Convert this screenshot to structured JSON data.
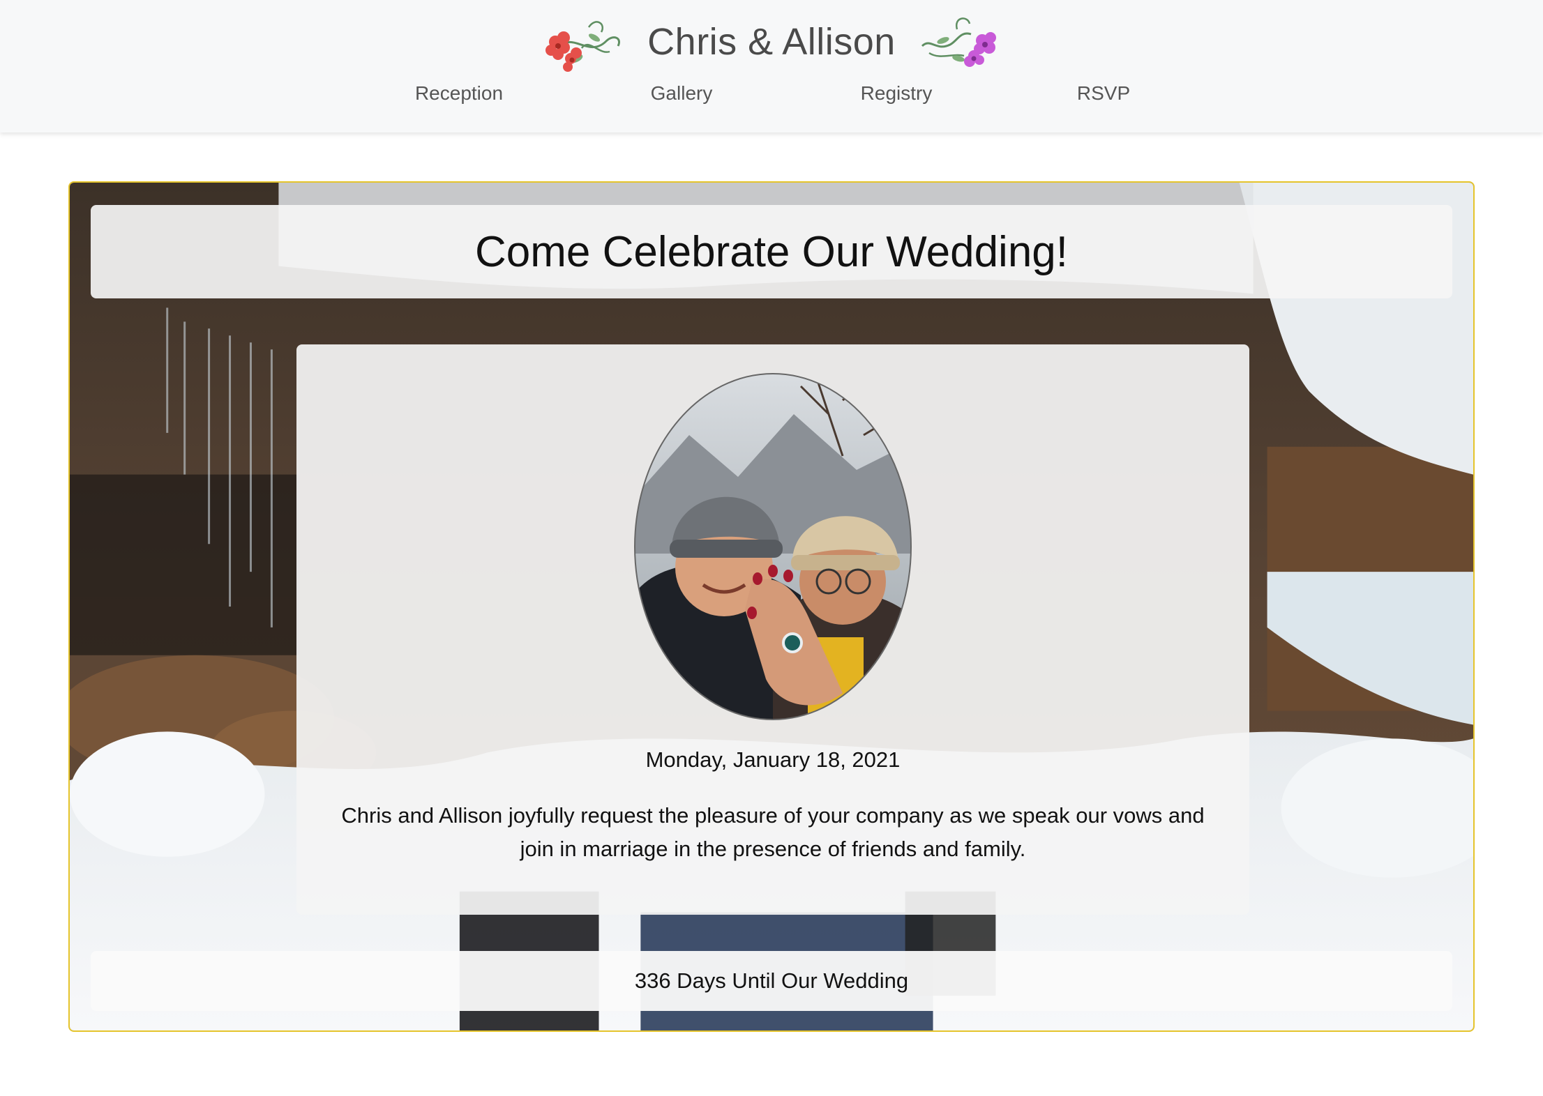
{
  "site": {
    "brand": "Chris & Allison"
  },
  "nav": {
    "items": [
      {
        "label": "Reception"
      },
      {
        "label": "Gallery"
      },
      {
        "label": "Registry"
      },
      {
        "label": "RSVP"
      }
    ]
  },
  "hero": {
    "title": "Come Celebrate Our Wedding!",
    "date": "Monday, January 18, 2021",
    "message": "Chris and Allison joyfully request the pleasure of your company as we speak our vows and join in marriage in the presence of friends and family.",
    "countdown": "336 Days Until Our Wedding"
  },
  "icons": {
    "left_flower": "red-flower-icon",
    "right_flower": "purple-flower-icon"
  },
  "colors": {
    "accent_border": "#e5c42b",
    "left_flower": "#e5504a",
    "right_flower": "#c85ad8",
    "vine": "#5f8f62"
  }
}
